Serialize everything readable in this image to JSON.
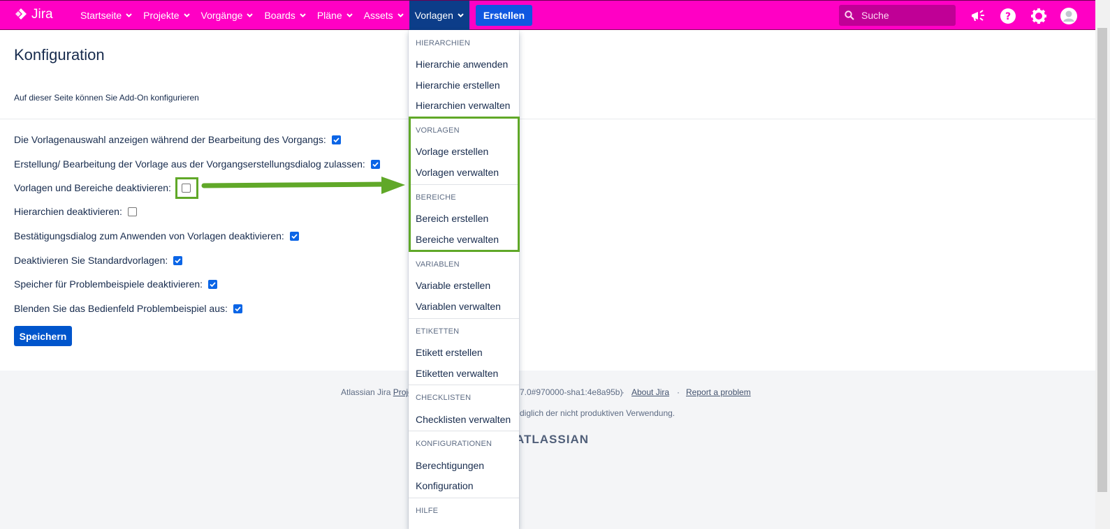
{
  "topbar": {
    "logo_text": "Jira",
    "nav": [
      "Startseite",
      "Projekte",
      "Vorgänge",
      "Boards",
      "Pläne",
      "Assets",
      "Vorlagen"
    ],
    "create_label": "Erstellen",
    "search_placeholder": "Suche",
    "bg_color": "#ff00c4"
  },
  "page": {
    "title": "Konfiguration",
    "description": "Auf dieser Seite können Sie Add-On konfigurieren",
    "options": [
      {
        "label": "Die Vorlagenauswahl anzeigen während der Bearbeitung des Vorgangs:",
        "checked": true
      },
      {
        "label": "Erstellung/ Bearbeitung der Vorlage aus der Vorgangserstellungsdialog zulassen:",
        "checked": true
      },
      {
        "label": "Vorlagen und Bereiche deaktivieren:",
        "checked": false
      },
      {
        "label": "Hierarchien deaktivieren:",
        "checked": false
      },
      {
        "label": "Bestätigungsdialog zum Anwenden von Vorlagen deaktivieren:",
        "checked": true
      },
      {
        "label": "Deaktivieren Sie Standardvorlagen:",
        "checked": true
      },
      {
        "label": "Speicher für Problembeispiele deaktivieren:",
        "checked": true
      },
      {
        "label": "Blenden Sie das Bedienfeld Problembeispiel aus:",
        "checked": true
      }
    ],
    "save_label": "Speichern"
  },
  "footer": {
    "prefix": "Atlassian Jira",
    "project_link": "Proje",
    "version_tail": "7.0#970000-sha1:4e8a95b)",
    "about": "About Jira",
    "report": "Report a problem",
    "license_tail": "diglich der nicht produktiven Verwendung.",
    "atlassian": "ATLASSIAN"
  },
  "menu": {
    "sections": [
      {
        "header": "HIERARCHIEN",
        "items": [
          "Hierarchie anwenden",
          "Hierarchie erstellen",
          "Hierarchien verwalten"
        ]
      },
      {
        "header": "VORLAGEN",
        "items": [
          "Vorlage erstellen",
          "Vorlagen verwalten"
        ]
      },
      {
        "header": "BEREICHE",
        "items": [
          "Bereich erstellen",
          "Bereiche verwalten"
        ]
      },
      {
        "header": "VARIABLEN",
        "items": [
          "Variable erstellen",
          "Variablen verwalten"
        ]
      },
      {
        "header": "ETIKETTEN",
        "items": [
          "Etikett erstellen",
          "Etiketten verwalten"
        ]
      },
      {
        "header": "CHECKLISTEN",
        "items": [
          "Checklisten verwalten"
        ]
      },
      {
        "header": "KONFIGURATIONEN",
        "items": [
          "Berechtigungen",
          "Konfiguration"
        ]
      },
      {
        "header": "HILFE",
        "items": []
      }
    ]
  },
  "annotation": {
    "highlight_color": "#60a828"
  }
}
